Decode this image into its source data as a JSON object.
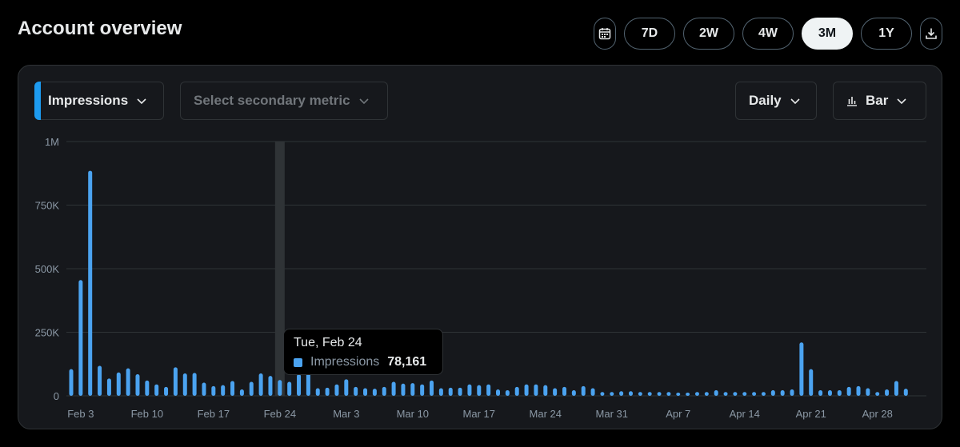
{
  "header": {
    "title": "Account overview"
  },
  "ranges": [
    {
      "label": "7D",
      "active": false
    },
    {
      "label": "2W",
      "active": false
    },
    {
      "label": "4W",
      "active": false
    },
    {
      "label": "3M",
      "active": true
    },
    {
      "label": "1Y",
      "active": false
    }
  ],
  "icons": {
    "calendar": "calendar-icon",
    "download": "download-icon",
    "chevron": "chevron-down-icon",
    "bar": "bar-chart-icon"
  },
  "controls": {
    "primary_metric": "Impressions",
    "secondary_metric_placeholder": "Select secondary metric",
    "interval": "Daily",
    "chart_type": "Bar"
  },
  "colors": {
    "accent": "#1d9bf0",
    "bar": "#4ba3f0",
    "active_range_bg": "#eff3f4"
  },
  "tooltip": {
    "date": "Tue, Feb 24",
    "metric": "Impressions",
    "value": "78,161"
  },
  "chart_data": {
    "type": "bar",
    "title": "",
    "xlabel": "",
    "ylabel": "",
    "ylim": [
      0,
      1000000
    ],
    "y_ticks": [
      "0",
      "250K",
      "500K",
      "750K",
      "1M"
    ],
    "x_tick_labels": [
      "Feb 3",
      "Feb 10",
      "Feb 17",
      "Feb 24",
      "Mar 3",
      "Mar 10",
      "Mar 17",
      "Mar 24",
      "Mar 31",
      "Apr 7",
      "Apr 14",
      "Apr 21",
      "Apr 28"
    ],
    "highlight_category": "Feb 24",
    "categories": [
      "Feb 2",
      "Feb 3",
      "Feb 4",
      "Feb 5",
      "Feb 6",
      "Feb 7",
      "Feb 8",
      "Feb 9",
      "Feb 10",
      "Feb 11",
      "Feb 12",
      "Feb 13",
      "Feb 14",
      "Feb 15",
      "Feb 16",
      "Feb 17",
      "Feb 18",
      "Feb 19",
      "Feb 20",
      "Feb 21",
      "Feb 22",
      "Feb 23",
      "Feb 24",
      "Feb 25",
      "Feb 26",
      "Feb 27",
      "Feb 28",
      "Mar 1",
      "Mar 2",
      "Mar 3",
      "Mar 4",
      "Mar 5",
      "Mar 6",
      "Mar 7",
      "Mar 8",
      "Mar 9",
      "Mar 10",
      "Mar 11",
      "Mar 12",
      "Mar 13",
      "Mar 14",
      "Mar 15",
      "Mar 16",
      "Mar 17",
      "Mar 18",
      "Mar 19",
      "Mar 20",
      "Mar 21",
      "Mar 22",
      "Mar 23",
      "Mar 24",
      "Mar 25",
      "Mar 26",
      "Mar 27",
      "Mar 28",
      "Mar 29",
      "Mar 30",
      "Mar 31",
      "Apr 1",
      "Apr 2",
      "Apr 3",
      "Apr 4",
      "Apr 5",
      "Apr 6",
      "Apr 7",
      "Apr 8",
      "Apr 9",
      "Apr 10",
      "Apr 11",
      "Apr 12",
      "Apr 13",
      "Apr 14",
      "Apr 15",
      "Apr 16",
      "Apr 17",
      "Apr 18",
      "Apr 19",
      "Apr 20",
      "Apr 21",
      "Apr 22",
      "Apr 23",
      "Apr 24",
      "Apr 25",
      "Apr 26",
      "Apr 27",
      "Apr 28",
      "Apr 29",
      "Apr 30",
      "May 1",
      "May 2",
      "May 3"
    ],
    "series": [
      {
        "name": "Impressions",
        "values": [
          105000,
          455000,
          885000,
          118000,
          68000,
          92000,
          108000,
          85000,
          60000,
          45000,
          35000,
          112000,
          88000,
          90000,
          52000,
          38000,
          42000,
          58000,
          25000,
          55000,
          88000,
          78161,
          62000,
          55000,
          85000,
          95000,
          30000,
          32000,
          45000,
          65000,
          35000,
          30000,
          28000,
          35000,
          55000,
          48000,
          50000,
          45000,
          60000,
          30000,
          32000,
          32000,
          45000,
          42000,
          45000,
          25000,
          22000,
          35000,
          45000,
          45000,
          42000,
          30000,
          35000,
          22000,
          38000,
          30000,
          15000,
          15000,
          18000,
          18000,
          15000,
          15000,
          15000,
          15000,
          12000,
          12000,
          15000,
          15000,
          22000,
          15000,
          15000,
          15000,
          15000,
          15000,
          22000,
          22000,
          25000,
          210000,
          105000,
          22000,
          22000,
          22000,
          35000,
          38000,
          30000,
          15000,
          25000,
          58000,
          28000,
          0,
          0
        ]
      }
    ]
  }
}
